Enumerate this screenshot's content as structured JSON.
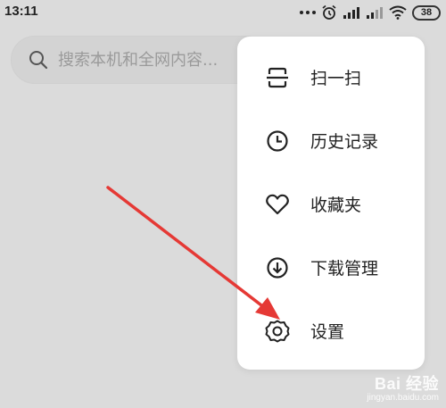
{
  "status_bar": {
    "time": "13:11",
    "battery": "38",
    "icons": [
      "more-dots-icon",
      "alarm-icon",
      "signal-icon",
      "signal-icon",
      "wifi-icon",
      "battery-icon"
    ]
  },
  "search": {
    "placeholder": "搜索本机和全网内容...",
    "icon": "search-icon"
  },
  "menu": {
    "items": [
      {
        "label": "扫一扫",
        "icon": "scan-icon"
      },
      {
        "label": "历史记录",
        "icon": "history-clock-icon"
      },
      {
        "label": "收藏夹",
        "icon": "heart-icon"
      },
      {
        "label": "下载管理",
        "icon": "download-icon"
      },
      {
        "label": "设置",
        "icon": "gear-icon"
      }
    ]
  },
  "annotation": {
    "color": "#e53935"
  },
  "watermark": {
    "main": "Bai 经验",
    "sub": "jingyan.baidu.com"
  }
}
